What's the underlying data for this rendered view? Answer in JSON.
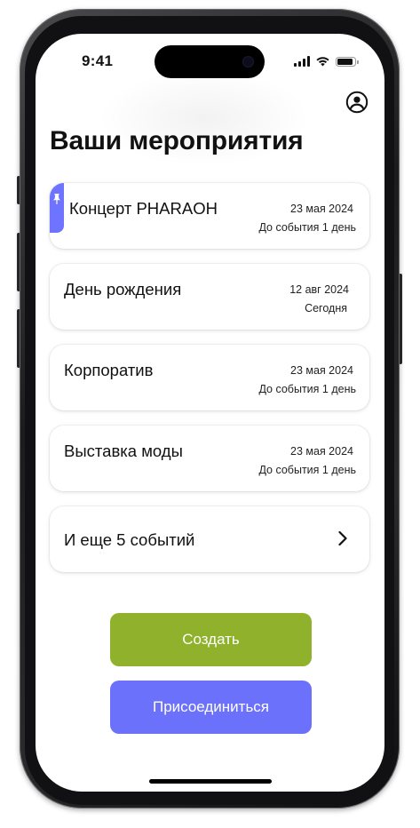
{
  "status_bar": {
    "time": "9:41"
  },
  "header": {
    "title": "Ваши мероприятия",
    "profile_icon": "user-circle-icon"
  },
  "events": [
    {
      "title": "Концерт PHARAOH",
      "date": "23 мая 2024",
      "countdown": "До события 1 день",
      "pinned": true
    },
    {
      "title": "День рождения",
      "date": "12 авг 2024",
      "countdown": "Сегодня",
      "pinned": false
    },
    {
      "title": "Корпоратив",
      "date": "23 мая 2024",
      "countdown": "До события 1 день",
      "pinned": false
    },
    {
      "title": "Выставка моды",
      "date": "23 мая 2024",
      "countdown": "До события 1 день",
      "pinned": false
    }
  ],
  "more": {
    "label": "И еще 5 событий",
    "icon": "chevron-right-icon"
  },
  "actions": {
    "create_label": "Создать",
    "join_label": "Присоединиться"
  },
  "colors": {
    "accent_pin": "#6e74ff",
    "create_button": "#8fb12c",
    "join_button": "#6c71fb",
    "text": "#111111",
    "background": "#ffffff"
  }
}
